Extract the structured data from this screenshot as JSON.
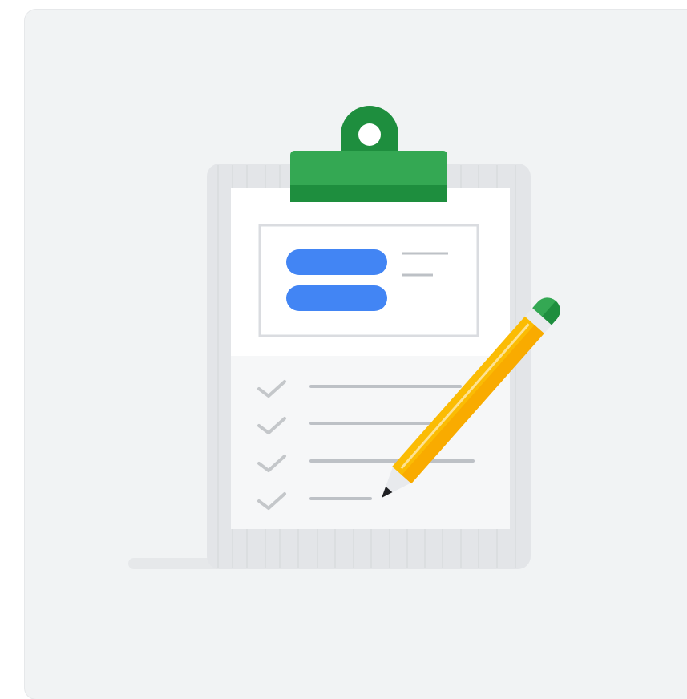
{
  "illustration": {
    "subject": "clipboard-checklist-with-pencil",
    "checklist_item_count": 4,
    "colors": {
      "background": "#f1f3f4",
      "clip_green": "#34a853",
      "clip_dark_green": "#1e8e3e",
      "board": "#e8eaed",
      "paper": "#ffffff",
      "header_bars": "#4285f4",
      "lines": "#bdc1c6",
      "checkmarks": "#bdc1c6",
      "pencil_body": "#fbbc04",
      "pencil_shade": "#f9ab00",
      "pencil_eraser": "#34a853",
      "pencil_tip": "#e0e0e0",
      "pencil_lead": "#202124"
    }
  }
}
